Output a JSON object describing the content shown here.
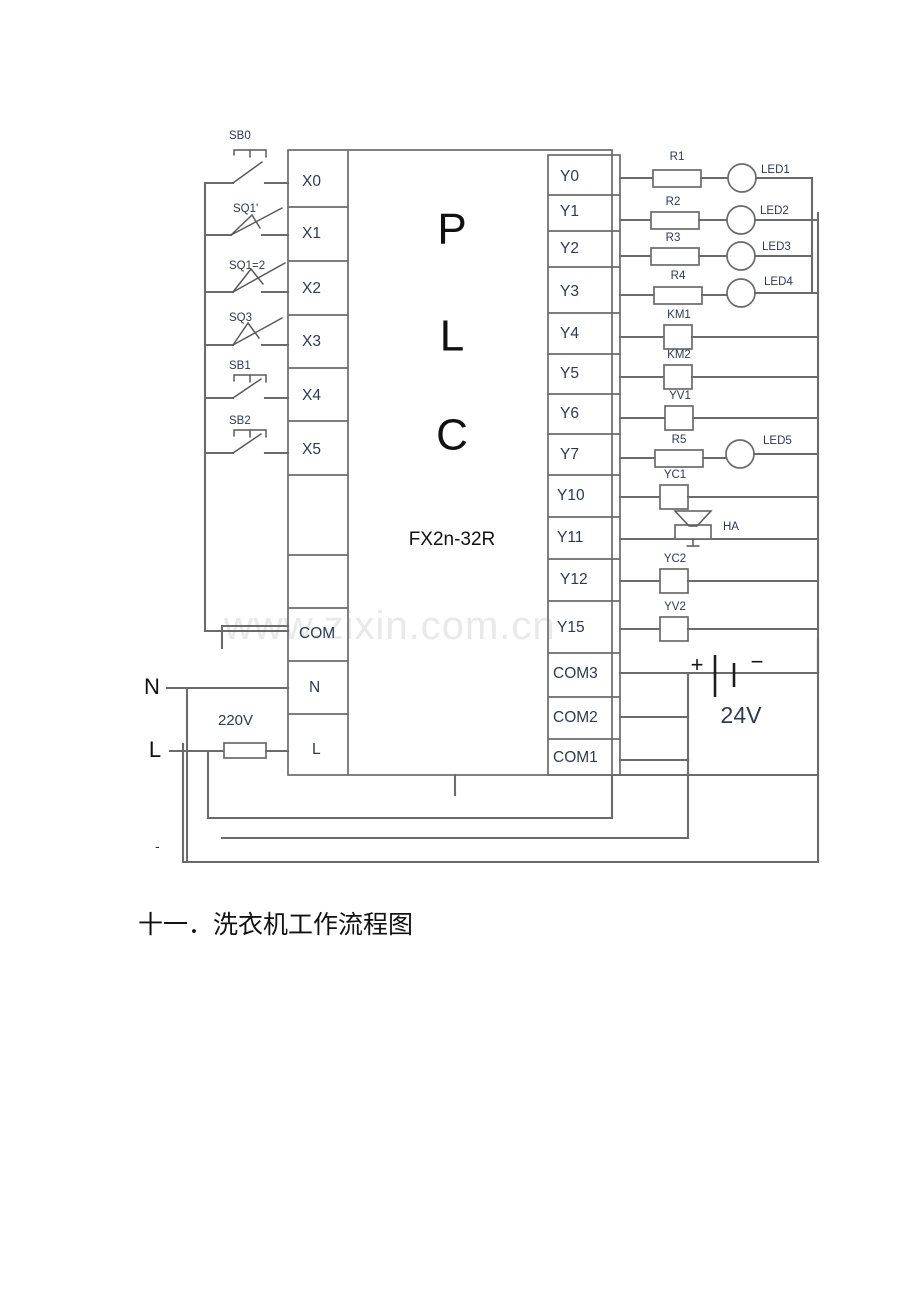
{
  "document": {
    "caption": "十一．洗衣机工作流程图",
    "watermark": "www.zixin.com.cn"
  },
  "plc": {
    "brand_letters": [
      "P",
      "L",
      "C"
    ],
    "model": "FX2n-32R",
    "input_terminals": [
      {
        "label": "X0"
      },
      {
        "label": "X1"
      },
      {
        "label": "X2"
      },
      {
        "label": "X3"
      },
      {
        "label": "X4"
      },
      {
        "label": "X5"
      },
      {
        "label": ""
      },
      {
        "label": ""
      },
      {
        "label": "COM"
      },
      {
        "label": "N"
      },
      {
        "label": "L"
      }
    ],
    "output_terminals": [
      {
        "label": "Y0"
      },
      {
        "label": "Y1"
      },
      {
        "label": "Y2"
      },
      {
        "label": "Y3"
      },
      {
        "label": "Y4"
      },
      {
        "label": "Y5"
      },
      {
        "label": "Y6"
      },
      {
        "label": "Y7"
      },
      {
        "label": "Y10"
      },
      {
        "label": "Y11"
      },
      {
        "label": "Y12"
      },
      {
        "label": "Y15"
      },
      {
        "label": "COM3"
      },
      {
        "label": "COM2"
      },
      {
        "label": "COM1"
      }
    ]
  },
  "inputs": [
    {
      "terminal": "X0",
      "device": "SB0",
      "type": "pushbutton"
    },
    {
      "terminal": "X1",
      "device": "SQ1'",
      "type": "limit-switch"
    },
    {
      "terminal": "X2",
      "device": "SQ1=2",
      "type": "limit-switch"
    },
    {
      "terminal": "X3",
      "device": "SQ3",
      "type": "limit-switch"
    },
    {
      "terminal": "X4",
      "device": "SB1",
      "type": "pushbutton"
    },
    {
      "terminal": "X5",
      "device": "SB2",
      "type": "pushbutton"
    }
  ],
  "outputs": [
    {
      "terminal": "Y0",
      "component": "R1",
      "component_type": "resistor",
      "load": "LED1",
      "load_type": "lamp"
    },
    {
      "terminal": "Y1",
      "component": "R2",
      "component_type": "resistor",
      "load": "LED2",
      "load_type": "lamp"
    },
    {
      "terminal": "Y2",
      "component": "R3",
      "component_type": "resistor",
      "load": "LED3",
      "load_type": "lamp"
    },
    {
      "terminal": "Y3",
      "component": "R4",
      "component_type": "resistor",
      "load": "LED4",
      "load_type": "lamp"
    },
    {
      "terminal": "Y4",
      "component": "KM1",
      "component_type": "coil",
      "load": "",
      "load_type": ""
    },
    {
      "terminal": "Y5",
      "component": "KM2",
      "component_type": "coil",
      "load": "",
      "load_type": ""
    },
    {
      "terminal": "Y6",
      "component": "YV1",
      "component_type": "coil",
      "load": "",
      "load_type": ""
    },
    {
      "terminal": "Y7",
      "component": "R5",
      "component_type": "resistor",
      "load": "LED5",
      "load_type": "lamp"
    },
    {
      "terminal": "Y10",
      "component": "YC1",
      "component_type": "coil",
      "load": "",
      "load_type": ""
    },
    {
      "terminal": "Y11",
      "component": "HA",
      "component_type": "buzzer",
      "load": "",
      "load_type": ""
    },
    {
      "terminal": "Y12",
      "component": "YC2",
      "component_type": "coil",
      "load": "",
      "load_type": ""
    },
    {
      "terminal": "Y15",
      "component": "YV2",
      "component_type": "coil",
      "load": "",
      "load_type": ""
    }
  ],
  "power": {
    "mains_neutral": "N",
    "mains_line": "L",
    "mains_voltage": "220V",
    "dc_voltage": "24V",
    "dc_plus": "+",
    "dc_minus": "−",
    "stray_mark": "-"
  }
}
